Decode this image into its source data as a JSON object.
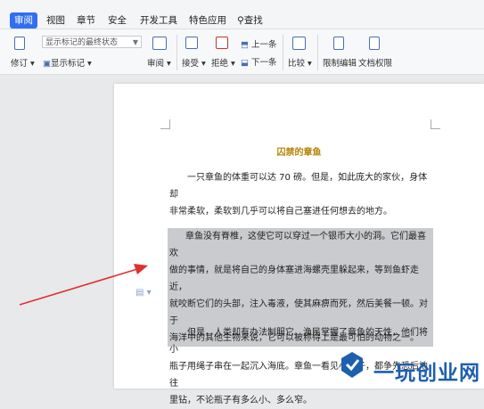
{
  "tabs": [
    {
      "label": "审阅",
      "active": true
    },
    {
      "label": "视图"
    },
    {
      "label": "章节"
    },
    {
      "label": "安全"
    },
    {
      "label": "开发工具"
    },
    {
      "label": "特色应用"
    },
    {
      "label": "查找"
    }
  ],
  "ribbon": {
    "track_changes": "修订",
    "markup_state": "显示标记的最终状态",
    "show_markup": "显示标记",
    "review": "审阅",
    "accept": "接受",
    "reject": "拒绝",
    "previous": "上一条",
    "next": "下一条",
    "compare": "比较",
    "restrict_editing": "限制编辑",
    "doc_permission": "文档权限"
  },
  "document": {
    "title": "囚禁的章鱼",
    "para1_line1": "一只章鱼的体重可以达 70 磅。但是，如此庞大的家伙，身体却",
    "para1_line2": "非常柔软，柔软到几乎可以将自己塞进任何想去的地方。",
    "para2_line1": "章鱼没有脊椎，这使它可以穿过一个银币大小的洞。它们最喜欢",
    "para2_line2": "做的事情，就是将自己的身体塞进海螺壳里躲起来，等到鱼虾走近，",
    "para2_line3": "就咬断它们的头部，注入毒液，使其麻痹而死，然后美餐一顿。对于",
    "para2_line4": "海洋中的其他生物来说，它可以被称得上是最可怕的动物之一。",
    "para3_line1": "但是，人类却有办法制服它。渔民掌握了章鱼的天性，他们将小",
    "para3_line2": "瓶子用绳子串在一起沉入海底。章鱼一看见小瓶子，都争先恐后地往",
    "para3_line3": "里钻，不论瓶子有多么小、多么窄。"
  },
  "watermark": {
    "text": "一玩创业网"
  },
  "colors": {
    "accent": "#2f6ff0",
    "title": "#b8860b",
    "highlight": "#c9cbce",
    "arrow": "#e03030"
  }
}
